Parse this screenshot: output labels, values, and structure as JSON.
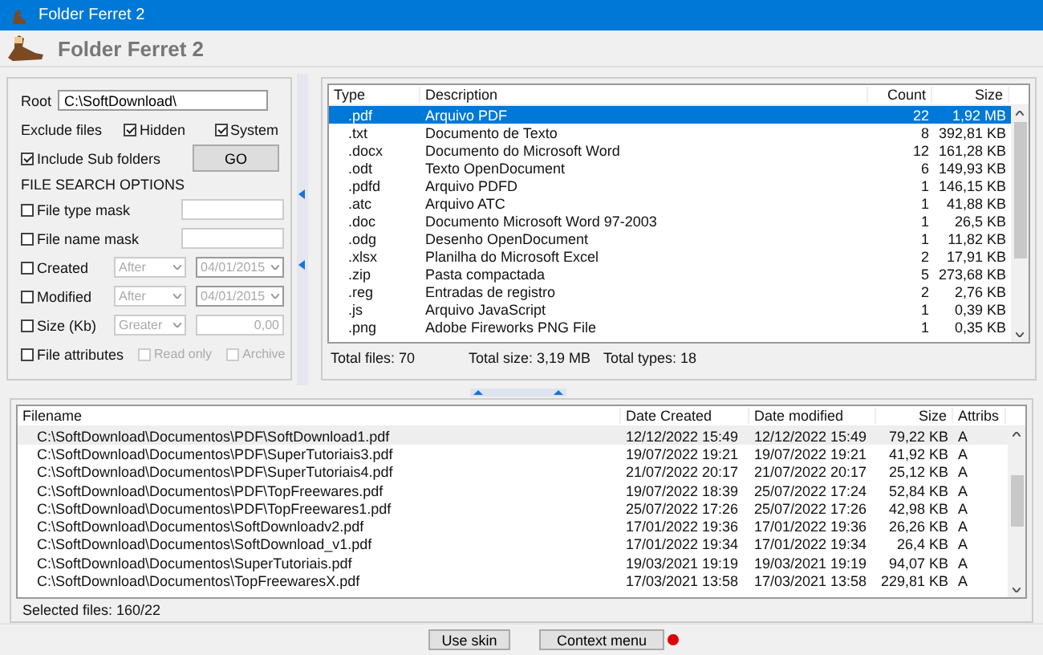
{
  "window": {
    "title": "Folder Ferret 2"
  },
  "header": {
    "title": "Folder Ferret 2"
  },
  "search": {
    "root_label": "Root",
    "root": "C:\\SoftDownload\\",
    "exclude_label": "Exclude files",
    "hidden": {
      "label": "Hidden",
      "checked": true
    },
    "system": {
      "label": "System",
      "checked": true
    },
    "subfolders": {
      "label": "Include Sub folders",
      "checked": true
    },
    "go": "GO",
    "options_title": "FILE SEARCH OPTIONS",
    "options": [
      {
        "kind": "mask",
        "label": "File type mask",
        "checked": false
      },
      {
        "kind": "mask",
        "label": "File name mask",
        "checked": false
      },
      {
        "kind": "date",
        "label": "Created",
        "checked": false,
        "mode": "After",
        "date": "04/01/2015"
      },
      {
        "kind": "date",
        "label": "Modified",
        "checked": false,
        "mode": "After",
        "date": "04/01/2015"
      },
      {
        "kind": "size",
        "label": "Size (Kb)",
        "checked": false,
        "mode": "Greater",
        "value": "0,00"
      },
      {
        "kind": "attributes",
        "label": "File attributes",
        "checked": false,
        "attrs": [
          {
            "label": "Read only",
            "checked": false,
            "disabled": true
          },
          {
            "label": "Archive",
            "checked": false,
            "disabled": true
          }
        ]
      }
    ]
  },
  "types": {
    "columns": [
      "Type",
      "Description",
      "Count",
      "Size"
    ],
    "rows": [
      {
        "type": ".pdf",
        "description": "Arquivo PDF",
        "count": "22",
        "size": "1,92 MB",
        "selected": true
      },
      {
        "type": ".txt",
        "description": "Documento de Texto",
        "count": "8",
        "size": "392,81 KB",
        "selected": false
      },
      {
        "type": ".docx",
        "description": "Documento do Microsoft Word",
        "count": "12",
        "size": "161,28 KB",
        "selected": false
      },
      {
        "type": ".odt",
        "description": "Texto OpenDocument",
        "count": "6",
        "size": "149,93 KB",
        "selected": false
      },
      {
        "type": ".pdfd",
        "description": "Arquivo PDFD",
        "count": "1",
        "size": "146,15 KB",
        "selected": false
      },
      {
        "type": ".atc",
        "description": "Arquivo ATC",
        "count": "1",
        "size": "41,88 KB",
        "selected": false
      },
      {
        "type": ".doc",
        "description": "Documento Microsoft Word 97-2003",
        "count": "1",
        "size": "26,5 KB",
        "selected": false
      },
      {
        "type": ".odg",
        "description": "Desenho OpenDocument",
        "count": "1",
        "size": "11,82 KB",
        "selected": false
      },
      {
        "type": ".xlsx",
        "description": "Planilha do Microsoft Excel",
        "count": "2",
        "size": "17,91 KB",
        "selected": false
      },
      {
        "type": ".zip",
        "description": "Pasta compactada",
        "count": "5",
        "size": "273,68 KB",
        "selected": false
      },
      {
        "type": ".reg",
        "description": "Entradas de registro",
        "count": "2",
        "size": "2,76 KB",
        "selected": false
      },
      {
        "type": ".js",
        "description": "Arquivo JavaScript",
        "count": "1",
        "size": "0,39 KB",
        "selected": false
      },
      {
        "type": ".png",
        "description": "Adobe Fireworks PNG File",
        "count": "1",
        "size": "0,35 KB",
        "selected": false
      }
    ],
    "totals": [
      "Total files: 70",
      "Total size: 3,19 MB",
      "Total types: 18"
    ]
  },
  "files": {
    "columns": [
      "Filename",
      "Date Created",
      "Date modified",
      "Size",
      "Attribs"
    ],
    "rows": [
      {
        "filename": "C:\\SoftDownload\\Documentos\\PDF\\SoftDownload1.pdf",
        "created": "12/12/2022 15:49",
        "modified": "12/12/2022 15:49",
        "size": "79,22 KB",
        "attribs": "A",
        "selected": true
      },
      {
        "filename": "C:\\SoftDownload\\Documentos\\PDF\\SuperTutoriais3.pdf",
        "created": "19/07/2022 19:21",
        "modified": "19/07/2022 19:21",
        "size": "41,92 KB",
        "attribs": "A",
        "selected": false
      },
      {
        "filename": "C:\\SoftDownload\\Documentos\\PDF\\SuperTutoriais4.pdf",
        "created": "21/07/2022 20:17",
        "modified": "21/07/2022 20:17",
        "size": "25,12 KB",
        "attribs": "A",
        "selected": false
      },
      {
        "filename": "C:\\SoftDownload\\Documentos\\PDF\\TopFreewares.pdf",
        "created": "19/07/2022 18:39",
        "modified": "25/07/2022 17:24",
        "size": "52,84 KB",
        "attribs": "A",
        "selected": false
      },
      {
        "filename": "C:\\SoftDownload\\Documentos\\PDF\\TopFreewares1.pdf",
        "created": "25/07/2022 17:26",
        "modified": "25/07/2022 17:26",
        "size": "42,98 KB",
        "attribs": "A",
        "selected": false
      },
      {
        "filename": "C:\\SoftDownload\\Documentos\\SoftDownloadv2.pdf",
        "created": "17/01/2022 19:36",
        "modified": "17/01/2022 19:36",
        "size": "26,26 KB",
        "attribs": "A",
        "selected": false
      },
      {
        "filename": "C:\\SoftDownload\\Documentos\\SoftDownload_v1.pdf",
        "created": "17/01/2022 19:34",
        "modified": "17/01/2022 19:34",
        "size": "26,4 KB",
        "attribs": "A",
        "selected": false
      },
      {
        "filename": "C:\\SoftDownload\\Documentos\\SuperTutoriais.pdf",
        "created": "19/03/2021 19:19",
        "modified": "19/03/2021 19:19",
        "size": "94,07 KB",
        "attribs": "A",
        "selected": false
      },
      {
        "filename": "C:\\SoftDownload\\Documentos\\TopFreewaresX.pdf",
        "created": "17/03/2021 13:58",
        "modified": "17/03/2021 13:58",
        "size": "229,81 KB",
        "attribs": "A",
        "selected": false
      }
    ],
    "status": "Selected files: 160/22"
  },
  "bottom": {
    "skin_button": "Use skin",
    "context_button": "Context menu",
    "context_on": true
  }
}
